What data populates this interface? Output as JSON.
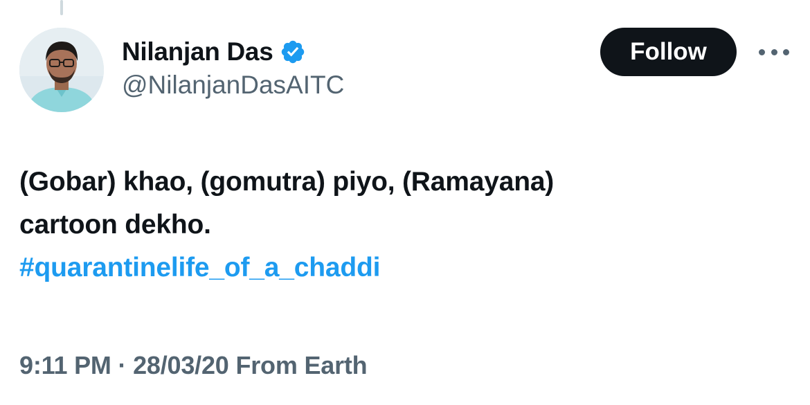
{
  "author": {
    "display_name": "Nilanjan Das",
    "handle": "@NilanjanDasAITC",
    "verified": true
  },
  "actions": {
    "follow_label": "Follow",
    "more_icon": "more-horizontal-icon"
  },
  "tweet": {
    "line1": "(Gobar) khao, (gomutra) piyo, (Ramayana)",
    "line2": "cartoon dekho.",
    "hashtag": "#quarantinelife_of_a_chaddi"
  },
  "meta": {
    "time": "9:11 PM",
    "separator": "·",
    "date": "28/03/20",
    "source": "From Earth"
  },
  "colors": {
    "text": "#0f1419",
    "secondary": "#536471",
    "link": "#1d9bf0",
    "verified": "#1d9bf0",
    "button_bg": "#0f1419"
  }
}
